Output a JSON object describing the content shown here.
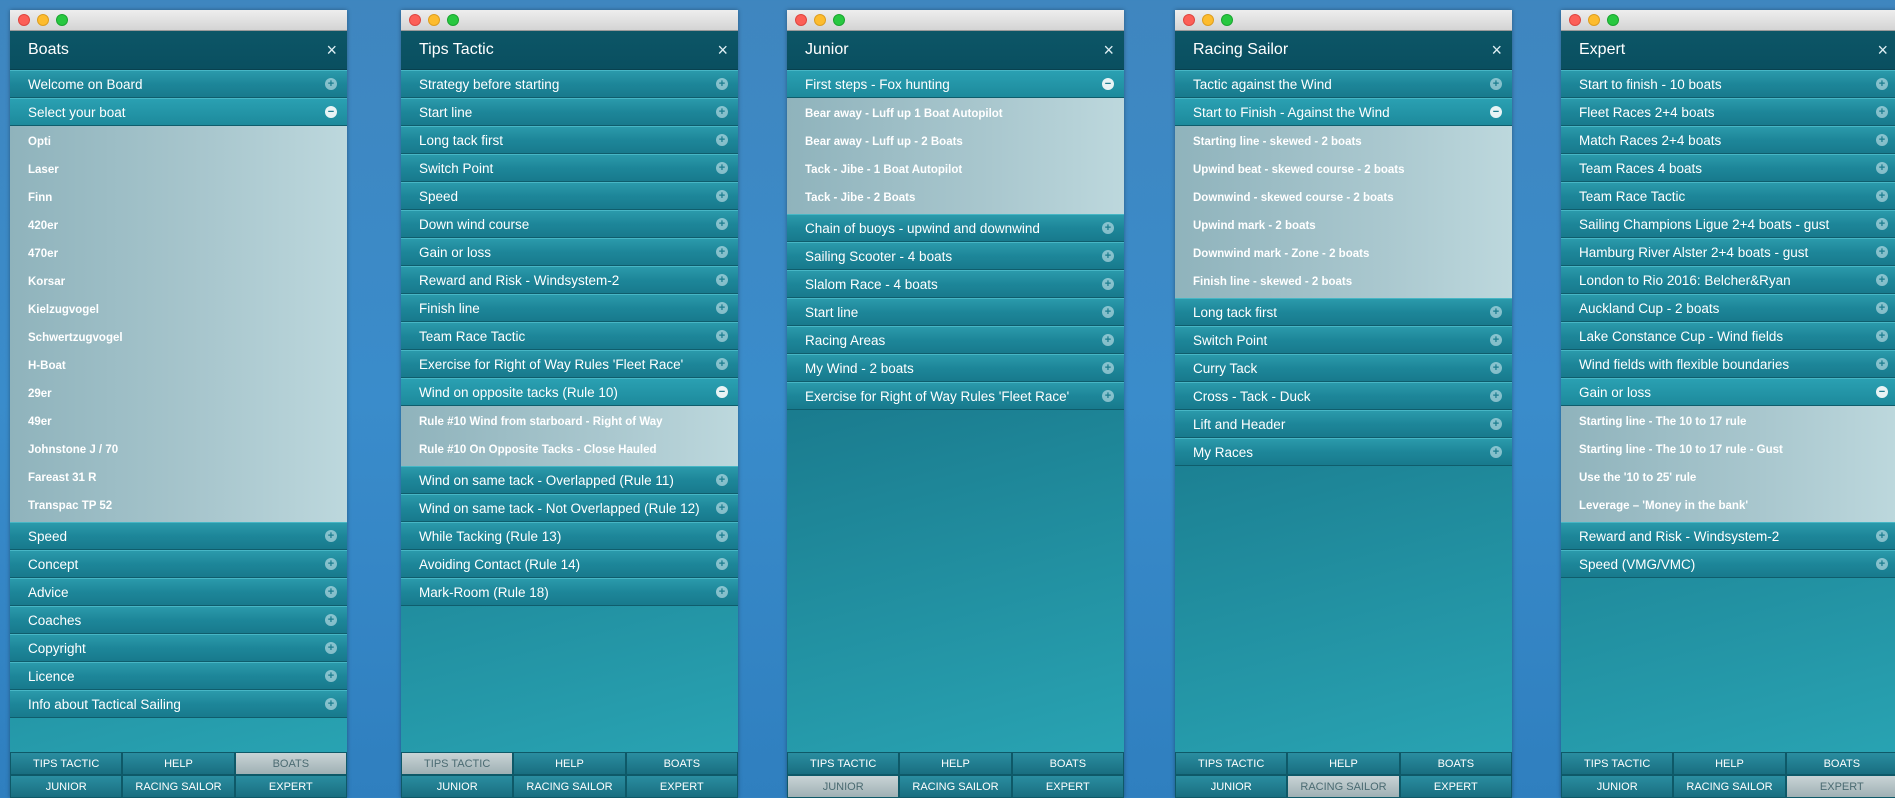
{
  "tabs": {
    "tips_tactic": "TIPS TACTIC",
    "help": "HELP",
    "boats": "BOATS",
    "junior": "JUNIOR",
    "racing_sailor": "RACING SAILOR",
    "expert": "EXPERT"
  },
  "windows": [
    {
      "title": "Boats",
      "items": [
        {
          "label": "Welcome on Board"
        },
        {
          "label": "Select your boat",
          "open": true,
          "sub": [
            "Opti",
            "Laser",
            "Finn",
            "420er",
            "470er",
            "Korsar",
            "Kielzugvogel",
            "Schwertzugvogel",
            "H-Boat",
            "29er",
            "49er",
            "Johnstone J / 70",
            "Fareast 31 R",
            "Transpac TP 52"
          ]
        },
        {
          "label": "Speed"
        },
        {
          "label": "Concept"
        },
        {
          "label": "Advice"
        },
        {
          "label": "Coaches"
        },
        {
          "label": "Copyright"
        },
        {
          "label": "Licence"
        },
        {
          "label": "Info about Tactical Sailing"
        }
      ],
      "active_tab": "boats"
    },
    {
      "title": "Tips Tactic",
      "items": [
        {
          "label": "Strategy before starting"
        },
        {
          "label": "Start line"
        },
        {
          "label": "Long tack first"
        },
        {
          "label": "Switch Point"
        },
        {
          "label": "Speed"
        },
        {
          "label": "Down wind course"
        },
        {
          "label": "Gain or loss"
        },
        {
          "label": "Reward and Risk - Windsystem-2"
        },
        {
          "label": "Finish line"
        },
        {
          "label": "Team Race Tactic"
        },
        {
          "label": "Exercise for Right of Way Rules 'Fleet Race'"
        },
        {
          "label": "Wind on opposite tacks (Rule 10)",
          "open": true,
          "sub": [
            "Rule #10 Wind from starboard - Right of Way",
            "Rule #10 On Opposite Tacks - Close Hauled"
          ]
        },
        {
          "label": "Wind on same tack - Overlapped (Rule 11)"
        },
        {
          "label": "Wind on same tack - Not Overlapped (Rule 12)"
        },
        {
          "label": "While Tacking (Rule 13)"
        },
        {
          "label": "Avoiding Contact (Rule 14)"
        },
        {
          "label": "Mark-Room (Rule 18)"
        }
      ],
      "active_tab": "tips_tactic"
    },
    {
      "title": "Junior",
      "items": [
        {
          "label": "First steps - Fox hunting",
          "open": true,
          "sub": [
            "Bear away - Luff up 1 Boat Autopilot",
            "Bear away - Luff up - 2 Boats",
            "Tack - Jibe - 1 Boat Autopilot",
            "Tack - Jibe - 2 Boats"
          ]
        },
        {
          "label": "Chain of buoys - upwind and downwind"
        },
        {
          "label": "Sailing Scooter - 4 boats"
        },
        {
          "label": "Slalom Race - 4 boats"
        },
        {
          "label": "Start line"
        },
        {
          "label": "Racing Areas"
        },
        {
          "label": "My Wind - 2 boats"
        },
        {
          "label": "Exercise for Right of Way Rules 'Fleet Race'"
        }
      ],
      "active_tab": "junior"
    },
    {
      "title": "Racing Sailor",
      "items": [
        {
          "label": "Tactic against the Wind"
        },
        {
          "label": "Start to Finish - Against the Wind",
          "open": true,
          "sub": [
            "Starting line - skewed - 2 boats",
            "Upwind beat - skewed course - 2 boats",
            "Downwind - skewed course - 2 boats",
            "Upwind mark - 2 boats",
            "Downwind mark - Zone - 2 boats",
            "Finish line - skewed - 2 boats"
          ]
        },
        {
          "label": "Long tack first"
        },
        {
          "label": "Switch Point"
        },
        {
          "label": "Curry Tack"
        },
        {
          "label": "Cross - Tack - Duck"
        },
        {
          "label": "Lift and Header"
        },
        {
          "label": "My Races"
        }
      ],
      "active_tab": "racing_sailor"
    },
    {
      "title": "Expert",
      "items": [
        {
          "label": "Start to finish - 10 boats"
        },
        {
          "label": "Fleet Races 2+4 boats"
        },
        {
          "label": "Match Races 2+4 boats"
        },
        {
          "label": "Team Races 4 boats"
        },
        {
          "label": "Team Race Tactic"
        },
        {
          "label": "Sailing Champions Ligue 2+4 boats - gust"
        },
        {
          "label": "Hamburg River Alster 2+4 boats - gust"
        },
        {
          "label": "London to Rio 2016: Belcher&Ryan"
        },
        {
          "label": "Auckland Cup - 2 boats"
        },
        {
          "label": "Lake Constance Cup - Wind fields"
        },
        {
          "label": "Wind fields with flexible boundaries"
        },
        {
          "label": "Gain or loss",
          "open": true,
          "sub": [
            "Starting line - The 10 to 17 rule",
            "Starting line - The 10 to 17 rule - Gust",
            "Use the '10 to 25' rule",
            "Leverage – 'Money in the bank'"
          ]
        },
        {
          "label": "Reward and Risk - Windsystem-2"
        },
        {
          "label": "Speed (VMG/VMC)"
        }
      ],
      "active_tab": "expert"
    }
  ]
}
